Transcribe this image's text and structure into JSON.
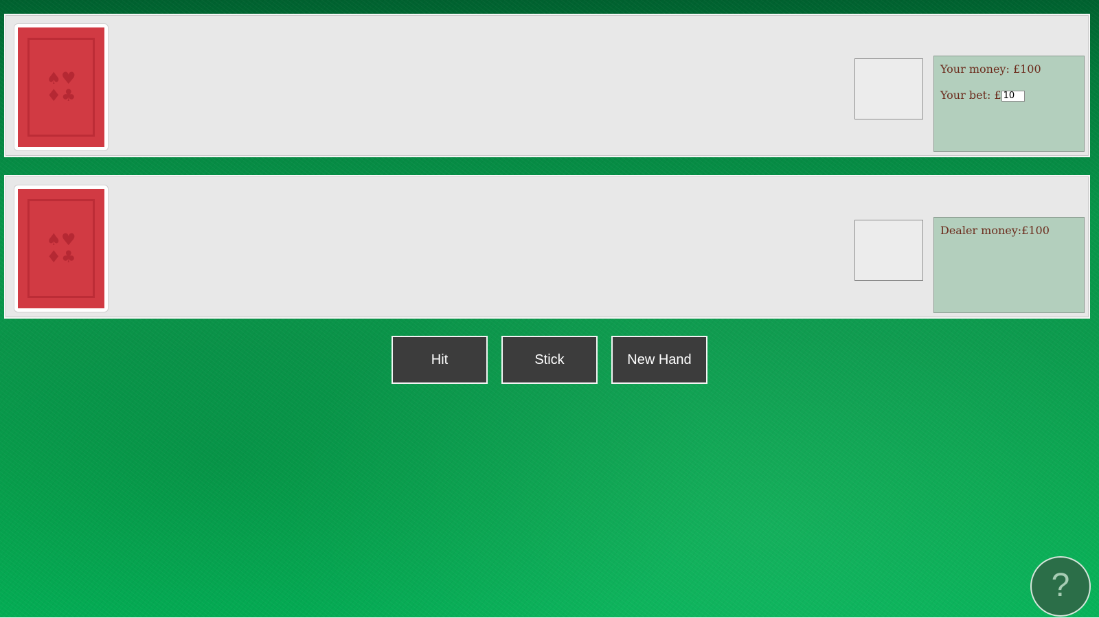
{
  "player": {
    "money_text": "Your money: £100",
    "bet_label": "Your bet: £",
    "bet_value": "10",
    "card_back_suits": "♠♥♦♣",
    "score_text": ""
  },
  "dealer": {
    "money_text": "Dealer money:£100",
    "card_back_suits": "♠♥♦♣",
    "score_text": ""
  },
  "actions": {
    "hit_label": "Hit",
    "stick_label": "Stick",
    "new_hand_label": "New Hand"
  },
  "help": {
    "label": "?",
    "icon": "question-mark-icon"
  },
  "colors": {
    "card_back": "#d13a43",
    "money_panel": "#b3cfbd",
    "money_text": "#6b2b1c",
    "button": "#3c3c3c",
    "felt": "#06a24a"
  }
}
